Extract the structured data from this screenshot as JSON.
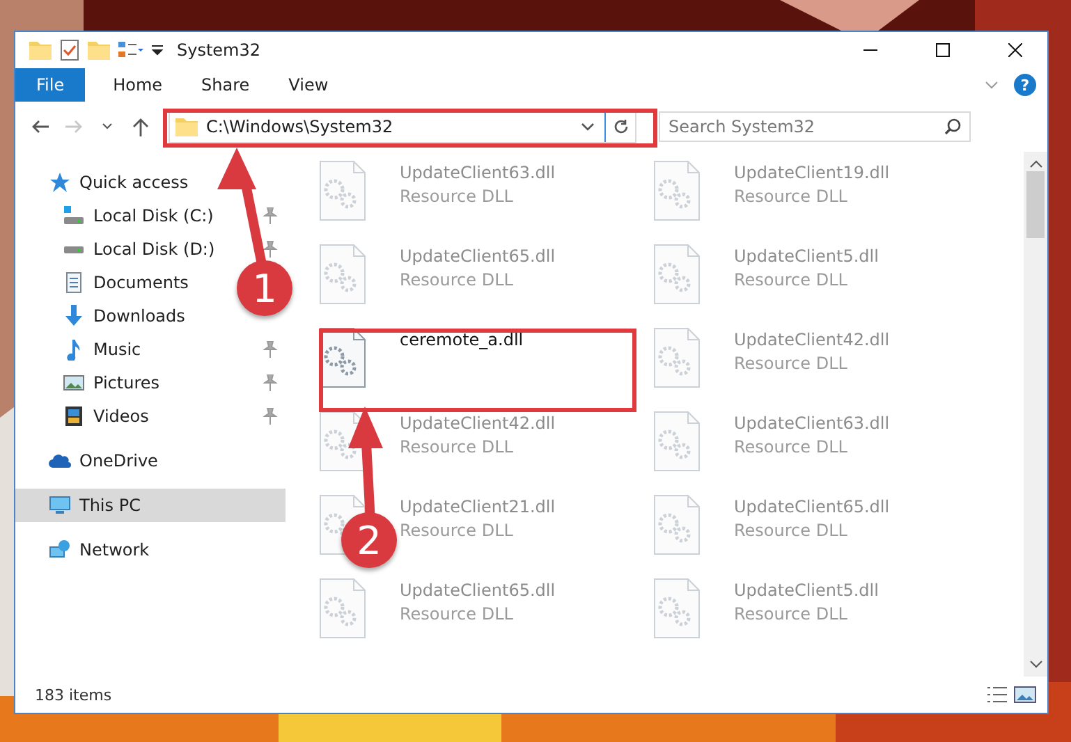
{
  "window": {
    "title": "System32",
    "ribbon_tabs": [
      {
        "label": "File",
        "kind": "file"
      },
      {
        "label": "Home",
        "kind": "tab"
      },
      {
        "label": "Share",
        "kind": "tab"
      },
      {
        "label": "View",
        "kind": "tab"
      }
    ],
    "help_label": "?"
  },
  "address_bar": {
    "path": "C:\\Windows\\System32",
    "back_disabled": false,
    "forward_disabled": true
  },
  "search": {
    "placeholder": "Search System32"
  },
  "sidebar": {
    "items": [
      {
        "label": "Quick access",
        "kind": "star",
        "selected": false,
        "children": [
          {
            "label": "Local Disk (C:)",
            "kind": "drive-windows",
            "pinned": true
          },
          {
            "label": "Local Disk (D:)",
            "kind": "drive",
            "pinned": true
          },
          {
            "label": "Documents",
            "kind": "documents"
          },
          {
            "label": "Downloads",
            "kind": "downloads"
          },
          {
            "label": "Music",
            "kind": "music",
            "pinned": true
          },
          {
            "label": "Pictures",
            "kind": "pictures",
            "pinned": true
          },
          {
            "label": "Videos",
            "kind": "videos",
            "pinned": true
          }
        ]
      },
      {
        "label": "OneDrive",
        "kind": "cloud",
        "selected": false
      },
      {
        "label": "This PC",
        "kind": "pc",
        "selected": true
      },
      {
        "label": "Network",
        "kind": "network",
        "selected": false
      }
    ]
  },
  "files": [
    {
      "name": "UpdateClient63.dll",
      "type": "Resource DLL",
      "highlighted": false
    },
    {
      "name": "UpdateClient19.dll",
      "type": "Resource DLL",
      "highlighted": false
    },
    {
      "name": "UpdateClient65.dll",
      "type": "Resource DLL",
      "highlighted": false
    },
    {
      "name": "UpdateClient5.dll",
      "type": "Resource DLL",
      "highlighted": false
    },
    {
      "name": "ceremote_a.dll",
      "highlighted": true
    },
    {
      "name": "UpdateClient42.dll",
      "type": "Resource DLL",
      "highlighted": false
    },
    {
      "name": "UpdateClient42.dll",
      "type": "Resource DLL",
      "highlighted": false
    },
    {
      "name": "UpdateClient63.dll",
      "type": "Resource DLL",
      "highlighted": false
    },
    {
      "name": "UpdateClient21.dll",
      "type": "Resource DLL",
      "highlighted": false
    },
    {
      "name": "UpdateClient65.dll",
      "type": "Resource DLL",
      "highlighted": false
    },
    {
      "name": "UpdateClient65.dll",
      "type": "Resource DLL",
      "highlighted": false
    },
    {
      "name": "UpdateClient5.dll",
      "type": "Resource DLL",
      "highlighted": false
    }
  ],
  "status_bar": {
    "count": "183 items"
  },
  "annotations": [
    {
      "label": "1"
    },
    {
      "label": "2"
    }
  ]
}
